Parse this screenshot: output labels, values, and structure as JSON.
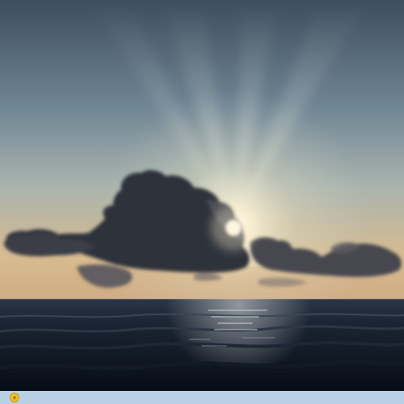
{
  "scene": {
    "subject": "sunset-over-sea-with-cloud",
    "colors": {
      "sky_top": "#3d4c5c",
      "sky_mid": "#7f98a5",
      "sky_horizon": "#d9b98a",
      "sun": "#fff8e6",
      "glow": "#fdf1cf",
      "cloud_dark": "#2d2f3a",
      "cloud_mid": "#474852",
      "sea_near": "#0b1320",
      "sea_far": "#2a3545",
      "sparkle": "#d8dde2"
    }
  },
  "taskbar": {
    "icon": "sun-icon",
    "icon_color": "#f2c12e",
    "bar_color": "#b9cfe6"
  }
}
